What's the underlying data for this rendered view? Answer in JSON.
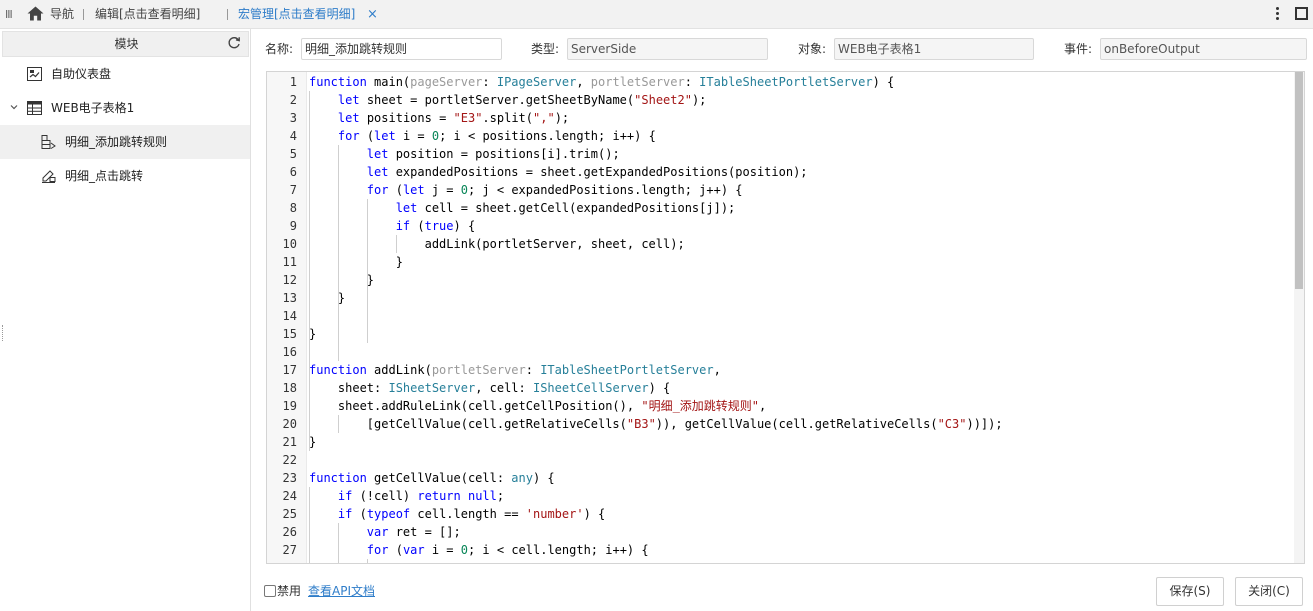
{
  "topbar": {
    "nav_label": "导航",
    "tab_edit_label": "编辑[点击查看明细]",
    "tab_macro_label": "宏管理[点击查看明细]",
    "close_glyph": "×"
  },
  "sidebar": {
    "header": "模块",
    "items": [
      {
        "label": "自助仪表盘"
      },
      {
        "label": "WEB电子表格1"
      },
      {
        "label": "明细_添加跳转规则"
      },
      {
        "label": "明细_点击跳转"
      }
    ]
  },
  "form": {
    "name_label": "名称:",
    "name_value": "明细_添加跳转规则",
    "type_label": "类型:",
    "type_value": "ServerSide",
    "object_label": "对象:",
    "object_value": "WEB电子表格1",
    "event_label": "事件:",
    "event_value": "onBeforeOutput"
  },
  "editor": {
    "line_numbers": [
      "1",
      "2",
      "3",
      "4",
      "5",
      "6",
      "7",
      "8",
      "9",
      "10",
      "11",
      "12",
      "13",
      "14",
      "15",
      "16",
      "17",
      "18",
      "19",
      "20",
      "21",
      "22",
      "23",
      "24",
      "25",
      "26",
      "27"
    ],
    "code_lines": [
      "function main(pageServer: IPageServer, portletServer: ITableSheetPortletServer) {",
      "    let sheet = portletServer.getSheetByName(\"Sheet2\");",
      "    let positions = \"E3\".split(\",\");",
      "    for (let i = 0; i < positions.length; i++) {",
      "        let position = positions[i].trim();",
      "        let expandedPositions = sheet.getExpandedPositions(position);",
      "        for (let j = 0; j < expandedPositions.length; j++) {",
      "            let cell = sheet.getCell(expandedPositions[j]);",
      "            if (true) {",
      "                addLink(portletServer, sheet, cell);",
      "            }",
      "        }",
      "    }",
      "",
      "}",
      "",
      "function addLink(portletServer: ITableSheetPortletServer,",
      "    sheet: ISheetServer, cell: ISheetCellServer) {",
      "    sheet.addRuleLink(cell.getCellPosition(), \"明细_添加跳转规则\",",
      "        [getCellValue(cell.getRelativeCells(\"B3\")), getCellValue(cell.getRelativeCells(\"C3\"))]);",
      "}",
      "",
      "function getCellValue(cell: any) {",
      "    if (!cell) return null;",
      "    if (typeof cell.length == 'number') {",
      "        var ret = [];",
      "        for (var i = 0; i < cell.length; i++) {"
    ]
  },
  "footer": {
    "disable_label": "禁用",
    "api_link": "查看API文档",
    "save_button": "保存(S)",
    "close_button": "关闭(C)"
  },
  "colors": {
    "accent": "#2f7dc9",
    "keyword": "#0000ff",
    "type": "#267f99",
    "string": "#a31515",
    "param": "#999999"
  }
}
